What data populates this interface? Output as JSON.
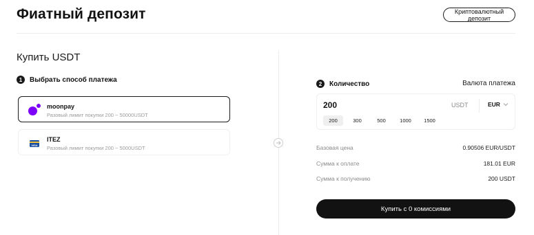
{
  "header": {
    "title": "Фиатный депозит",
    "crypto_deposit_label": "Криптовалютный депозит"
  },
  "buy": {
    "title": "Купить USDT"
  },
  "step1": {
    "number": "1",
    "label": "Выбрать способ платежа"
  },
  "providers": [
    {
      "name": "moonpay",
      "limit": "Разовый лимит покупки 200 ~ 50000USDT",
      "icon": "moonpay-logo",
      "selected": true
    },
    {
      "name": "ITEZ",
      "limit": "Разовый лимит покупки 200 ~ 5000USDT",
      "icon": "visa-card-icon",
      "selected": false
    }
  ],
  "step2": {
    "number": "2",
    "label": "Количество",
    "pay_currency_label": "Валюта платежа"
  },
  "amount": {
    "value": "200",
    "unit": "USDT",
    "currency": "EUR",
    "chips": [
      "200",
      "300",
      "500",
      "1000",
      "1500"
    ],
    "active_chip": "200"
  },
  "info": [
    {
      "label": "Базовая цена",
      "value": "0.90506 EUR/USDT"
    },
    {
      "label": "Сумма к оплате",
      "value": "181.01 EUR"
    },
    {
      "label": "Сумма к получению",
      "value": "200 USDT"
    }
  ],
  "buy_button_label": "Купить с 0 комиссиями",
  "colors": {
    "accent_dark": "#121212",
    "moonpay_purple": "#7d00ff",
    "muted_text": "#8a8a8a",
    "border": "#efefef"
  }
}
